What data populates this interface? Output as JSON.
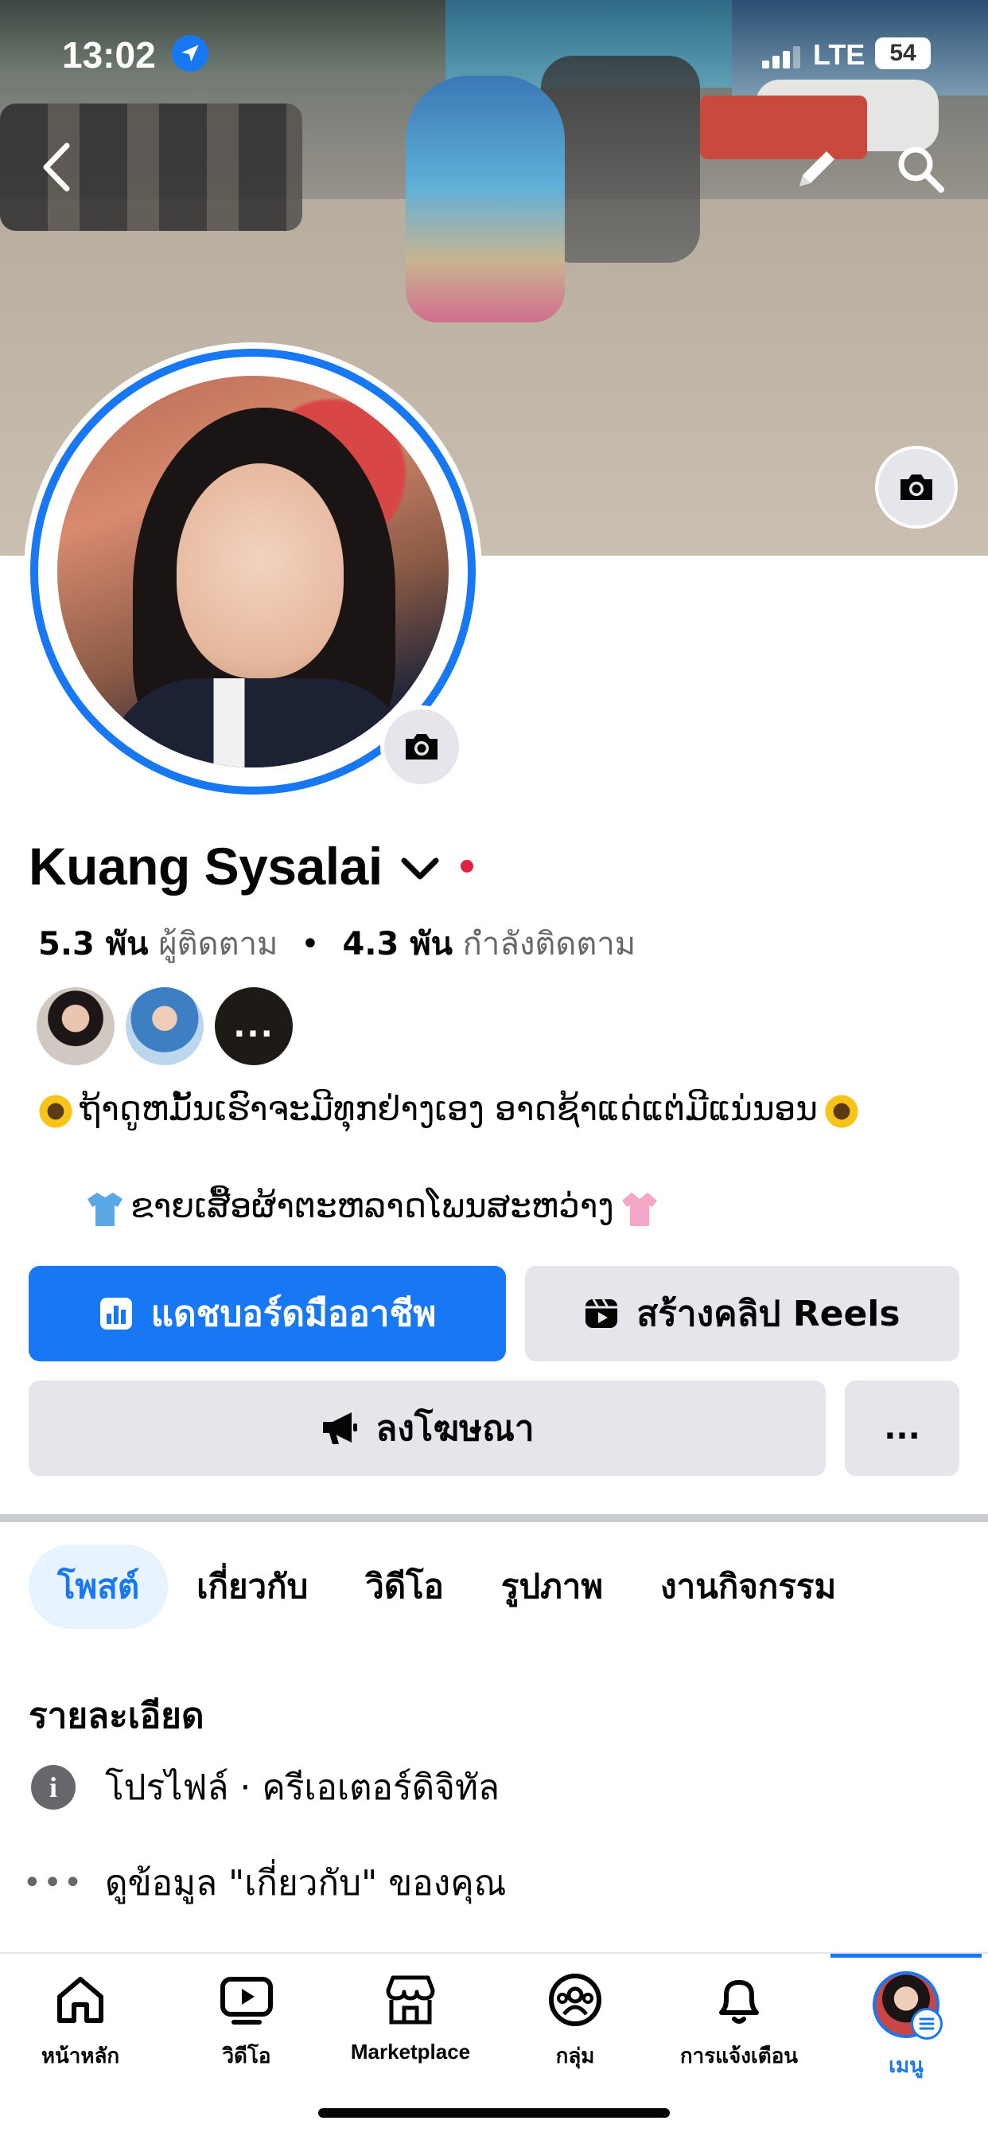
{
  "status_bar": {
    "time": "13:02",
    "network": "LTE",
    "battery": "54"
  },
  "profile": {
    "name": "Kuang Sysalai",
    "followers_count": "5.3 พัน",
    "followers_label": "ผู้ติดตาม",
    "following_count": "4.3 พัน",
    "following_label": "กำลังติดตาม",
    "stats_separator": "•",
    "more_friends": "...",
    "bio_line1": "ຖ້າດູຫມັ້ນເຮົາຈະມີທຸກຢ່າງເອງ ອາດຊ້າແດ່ແຕ່ມີແນ່ນອນ",
    "bio_line2": "ຂາຍເສື້ອຜ້າຕະຫລາດໂພນສະຫວ່າງ"
  },
  "actions": {
    "dashboard_label": "แดชบอร์ดมืออาชีพ",
    "reels_label": "สร้างคลิป Reels",
    "ads_label": "ลงโฆษณา",
    "more_label": "..."
  },
  "tabs": [
    {
      "label": "โพสต์",
      "active": true
    },
    {
      "label": "เกี่ยวกับ",
      "active": false
    },
    {
      "label": "วิดีโอ",
      "active": false
    },
    {
      "label": "รูปภาพ",
      "active": false
    },
    {
      "label": "งานกิจกรรม",
      "active": false
    }
  ],
  "details": {
    "title": "รายละเอียด",
    "profile_line": "โปรไฟล์ · ครีเอเตอร์ดิจิทัล",
    "about_link": "ดูข้อมูล \"เกี่ยวกับ\" ของคุณ"
  },
  "bottom_nav": [
    {
      "label": "หน้าหลัก",
      "icon": "home-icon"
    },
    {
      "label": "วิดีโอ",
      "icon": "video-icon"
    },
    {
      "label": "Marketplace",
      "icon": "marketplace-icon"
    },
    {
      "label": "กลุ่ม",
      "icon": "groups-icon"
    },
    {
      "label": "การแจ้งเตือน",
      "icon": "bell-icon"
    },
    {
      "label": "เมนู",
      "icon": "menu-avatar",
      "active": true
    }
  ],
  "colors": {
    "accent": "#1877f2",
    "button_gray": "#e4e6eb",
    "text_secondary": "#65676b",
    "online_dot": "#e41e3f"
  }
}
